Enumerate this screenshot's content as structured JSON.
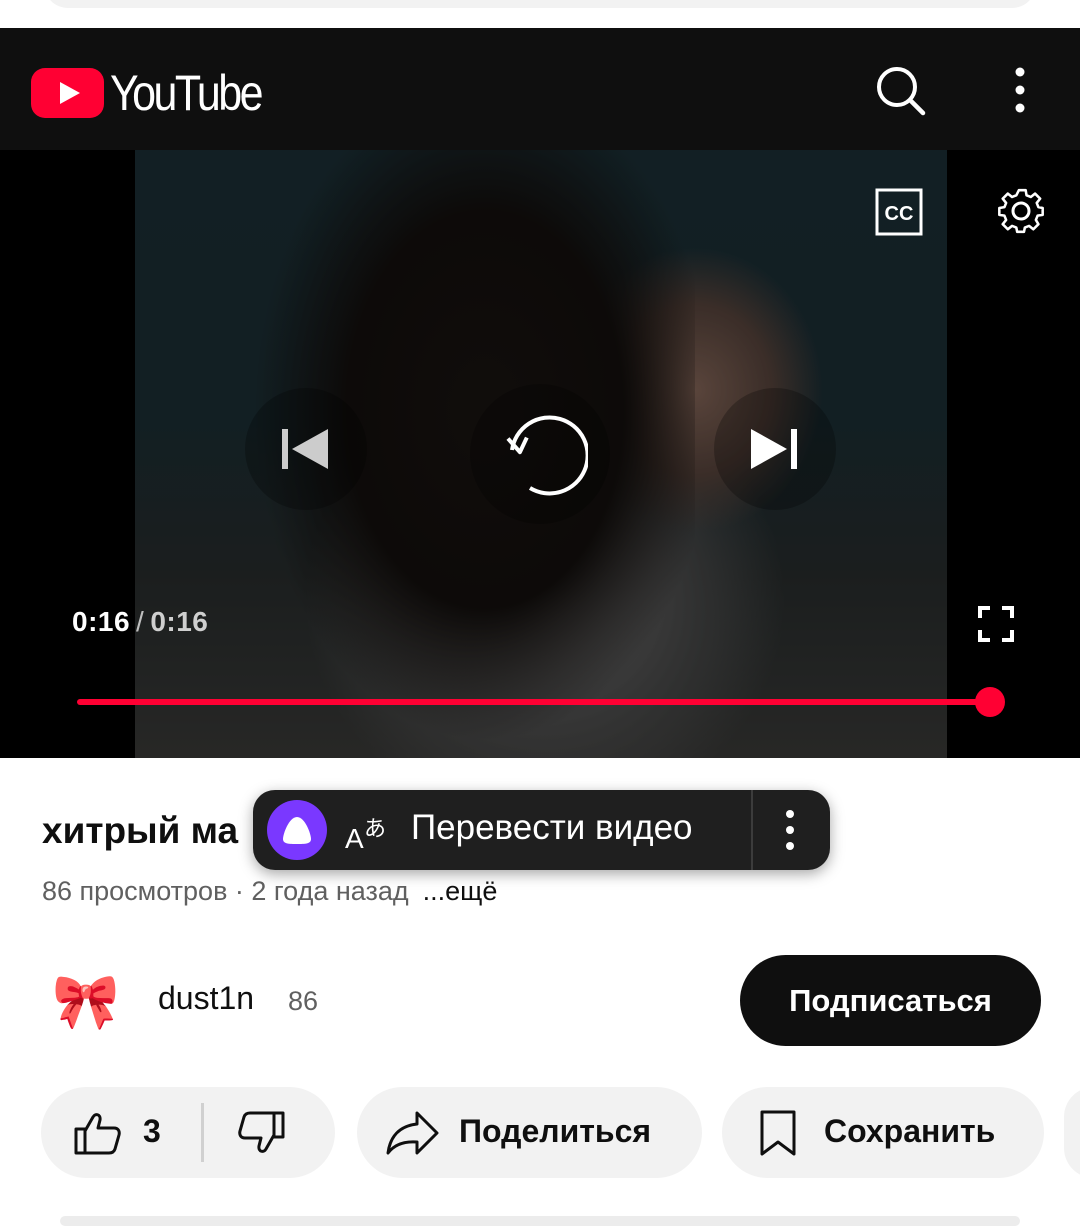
{
  "header": {
    "logo_text": "YouTube",
    "search_icon": "search-icon",
    "menu_icon": "more-vert-icon"
  },
  "player": {
    "current_time": "0:16",
    "separator": "/",
    "duration": "0:16",
    "progress": 1.0,
    "icons": [
      "closed-captions-icon",
      "settings-gear-icon",
      "previous-icon",
      "replay-icon",
      "next-icon",
      "fullscreen-icon"
    ]
  },
  "video": {
    "title": "хитрый ма",
    "meta": "86 просмотров · 2 года назад",
    "more": "...ещё"
  },
  "translate_popup": {
    "label": "Перевести видео",
    "icons": [
      "alice-icon",
      "translate-icon",
      "more-vert-icon"
    ]
  },
  "channel": {
    "avatar": "🎀",
    "name": "dust1n",
    "subscribers": "86",
    "subscribe_label": "Подписаться"
  },
  "actions": {
    "likes": "3",
    "share_label": "Поделиться",
    "save_label": "Сохранить"
  },
  "colors": {
    "brand_red": "#ff0033",
    "header_bg": "#0f0f0f",
    "alice_purple": "#7a38ff"
  }
}
